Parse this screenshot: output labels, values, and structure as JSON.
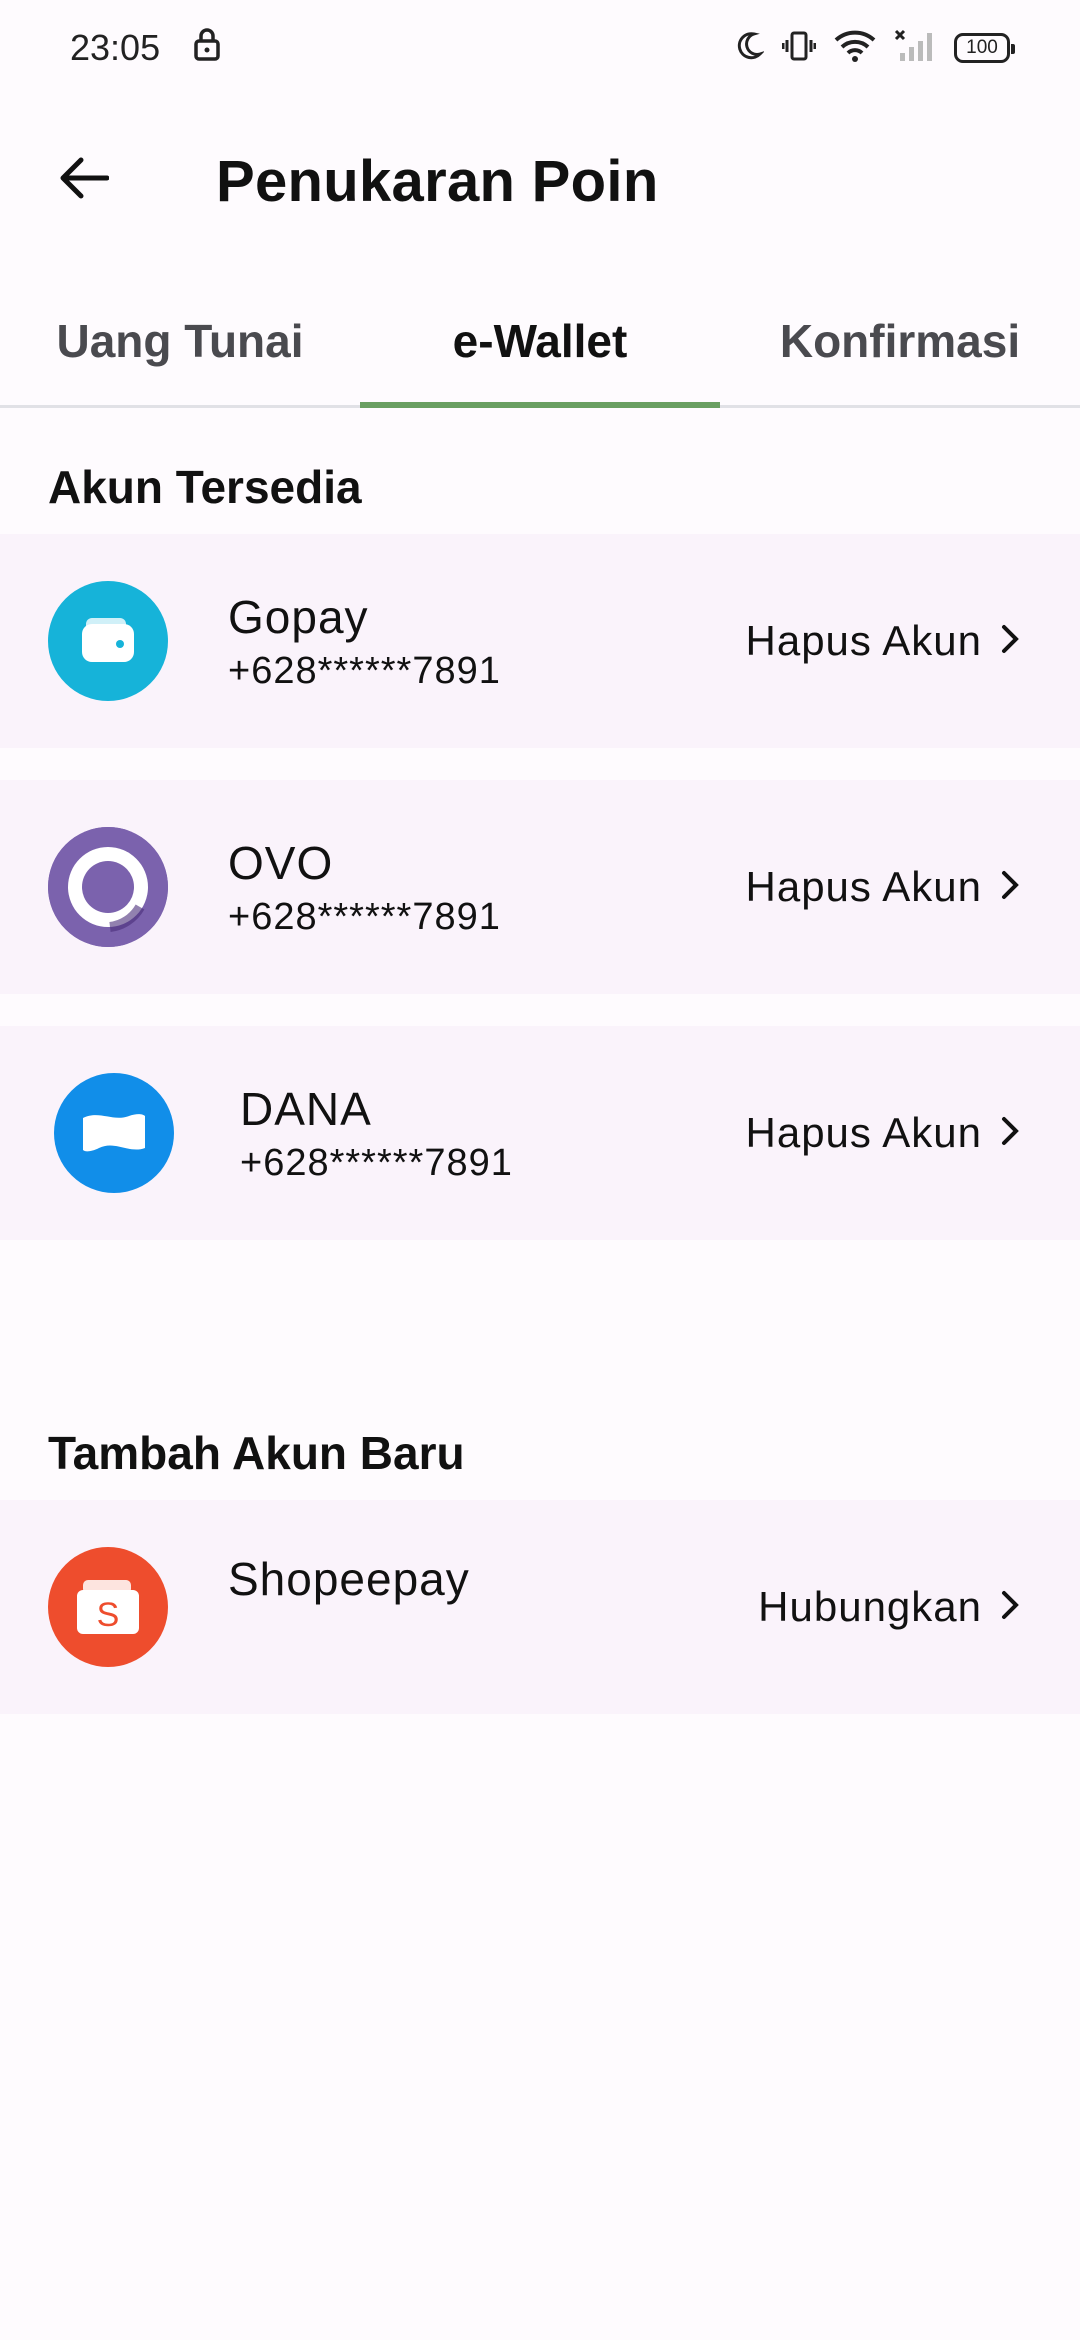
{
  "status": {
    "time": "23:05",
    "battery": "100",
    "icons": [
      "lock-icon",
      "moon-icon",
      "vibrate-icon",
      "wifi-icon",
      "signal-off-icon",
      "battery-icon"
    ]
  },
  "header": {
    "title": "Penukaran Poin",
    "back_icon": "arrow-left-icon"
  },
  "tabs": [
    {
      "label": "Uang Tunai",
      "active": false
    },
    {
      "label": "e-Wallet",
      "active": true
    },
    {
      "label": "Konfirmasi",
      "active": false
    }
  ],
  "accent_color": "#6a9f62",
  "sections": {
    "available_title": "Akun Tersedia",
    "add_title": "Tambah Akun Baru"
  },
  "accounts": [
    {
      "name": "Gopay",
      "phone": "+628******7891",
      "action": "Hapus Akun",
      "icon": "gopay-wallet-icon",
      "color": "#16b3d9"
    },
    {
      "name": "OVO",
      "phone": "+628******7891",
      "action": "Hapus Akun",
      "icon": "ovo-ring-icon",
      "color": "#7b62ad"
    },
    {
      "name": "DANA",
      "phone": "+628******7891",
      "action": "Hapus Akun",
      "icon": "dana-wave-icon",
      "color": "#118ee9"
    }
  ],
  "new_accounts": [
    {
      "name": "Shopeepay",
      "action": "Hubungkan",
      "icon": "shopeepay-bag-icon",
      "color": "#ee4d2d"
    }
  ]
}
